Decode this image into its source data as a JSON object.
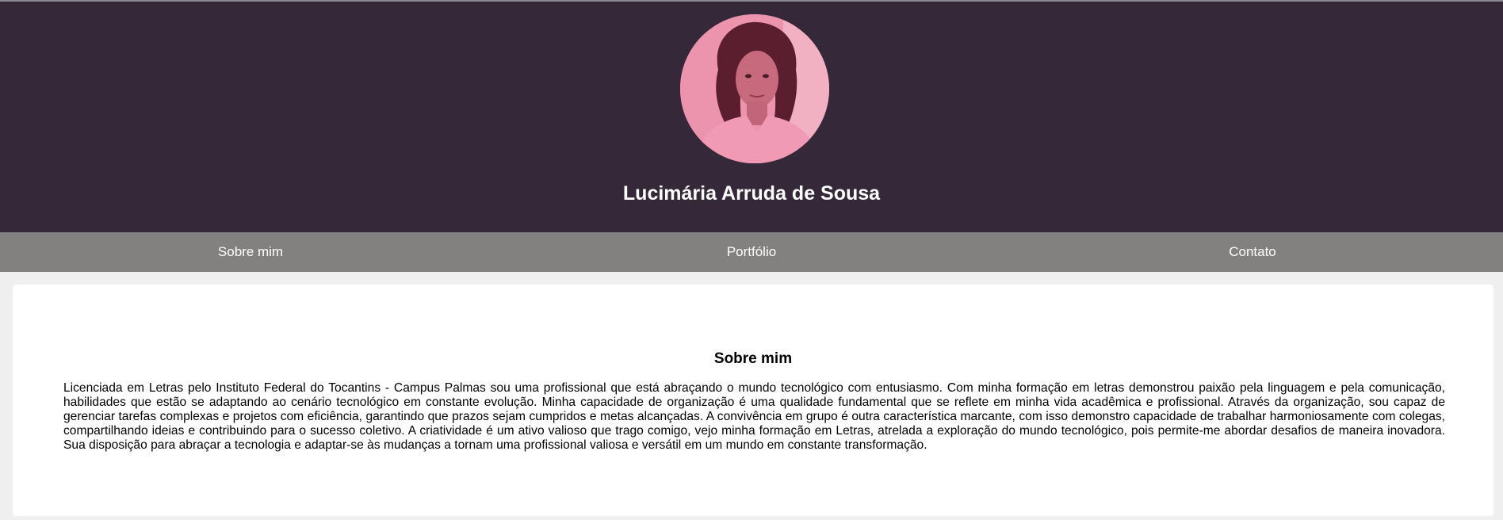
{
  "profile": {
    "name": "Lucimária Arruda de Sousa",
    "photo_icon": "profile-photo"
  },
  "nav": {
    "items": [
      "Sobre mim",
      "Portfólio",
      "Contato"
    ]
  },
  "about": {
    "title": "Sobre mim",
    "text": "Licenciada em Letras pelo Instituto Federal do Tocantins - Campus Palmas sou uma profissional que está abraçando o mundo tecnológico com entusiasmo. Com minha formação em letras demonstrou paixão pela linguagem e pela comunicação, habilidades que estão se adaptando ao cenário tecnológico em constante evolução. Minha capacidade de organização é uma qualidade fundamental que se reflete em minha vida acadêmica e profissional. Através da organização, sou capaz de gerenciar tarefas complexas e projetos com eficiência, garantindo que prazos sejam cumpridos e metas alcançadas. A convivência em grupo é outra característica marcante, com isso demonstro capacidade de trabalhar harmoniosamente com colegas, compartilhando ideias e contribuindo para o sucesso coletivo. A criatividade é um ativo valioso que trago comigo, vejo minha formação em Letras, atrelada a exploração do mundo tecnológico, pois permite-me abordar desafios de maneira inovadora. Sua disposição para abraçar a tecnologia e adaptar-se às mudanças a tornam uma profissional valiosa e versátil em um mundo em constante transformação."
  },
  "colors": {
    "header_bg": "#352838",
    "nav_bg": "#838080",
    "page_bg": "#efefef",
    "card_bg": "#ffffff",
    "photo_tint": "#ea8aa6"
  }
}
